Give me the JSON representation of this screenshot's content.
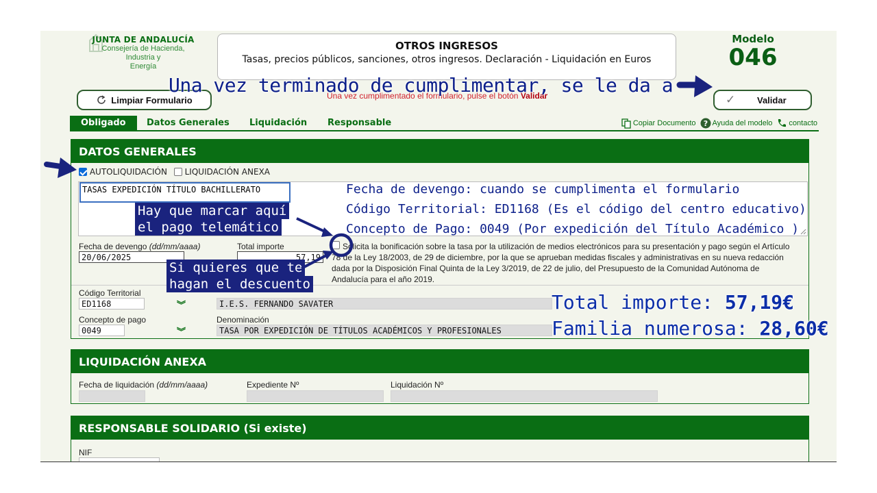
{
  "header": {
    "org_title": "JUNTA DE ANDALUCÍA",
    "org_line1": "Consejería de Hacienda, Industria y",
    "org_line2": "Energía",
    "form_title": "OTROS INGRESOS",
    "form_subtitle": "Tasas, precios públicos, sanciones, otros ingresos. Declaración - Liquidación en Euros",
    "modelo_label": "Modelo",
    "modelo_number": "046"
  },
  "toolbar": {
    "limpiar_label": "Limpiar Formulario",
    "validar_label": "Validar",
    "hint_text": "Una vez cumplimentado el formulario, pulse el botón",
    "hint_bold": "Validar"
  },
  "tabs": [
    {
      "label": "Obligado",
      "active": true
    },
    {
      "label": "Datos Generales",
      "active": false
    },
    {
      "label": "Liquidación",
      "active": false
    },
    {
      "label": "Responsable",
      "active": false
    }
  ],
  "tools": {
    "copiar": "Copiar Documento",
    "ayuda": "Ayuda del modelo",
    "contacto": "contacto"
  },
  "datos_generales": {
    "heading": "DATOS GENERALES",
    "autoliquidacion_label": "AUTOLIQUIDACIÓN",
    "autoliquidacion_checked": true,
    "anexa_label": "LIQUIDACIÓN ANEXA",
    "anexa_checked": false,
    "descripcion": "TASAS EXPEDICIÓN TÍTULO BACHILLERATO",
    "fecha_label": "Fecha de devengo",
    "fecha_format": "(dd/mm/aaaa)",
    "fecha_value": "20/06/2025",
    "total_label": "Total importe",
    "total_value": "57,19",
    "bonificacion_checked": false,
    "bonificacion_text": "Solicita la bonificación sobre la tasa por la utilización de medios electrónicos para su presentación y pago según el Artículo 78 de la Ley 18/2003, de 29 de diciembre, por la que se aprueban medidas fiscales y administrativas en su nueva redacción dada por la Disposición Final Quinta de la Ley 3/2019, de 22 de julio, del Presupuesto de la Comunidad Autónoma de Andalucía para el año 2019.",
    "codigo_label": "Código Territorial",
    "codigo_value": "ED1168",
    "centro_value": "I.E.S. FERNANDO SAVATER",
    "concepto_label": "Concepto de pago",
    "concepto_value": "0049",
    "denominacion_label": "Denominación",
    "denominacion_value": "TASA POR EXPEDICIÓN  DE TÍTULOS ACADÉMICOS Y PROFESIONALES"
  },
  "liquidacion_anexa": {
    "heading": "LIQUIDACIÓN ANEXA",
    "fecha_label": "Fecha de liquidación",
    "fecha_format": "(dd/mm/aaaa)",
    "expediente_label": "Expediente Nº",
    "liquidacion_label": "Liquidación Nº"
  },
  "responsable": {
    "heading": "RESPONSABLE SOLIDARIO (Si existe)",
    "nif_label": "NIF"
  },
  "annotations": {
    "top": "Una vez terminado de cumplimentar, se le da a",
    "fecha_note": "Fecha de devengo: cuando se cumplimenta el formulario",
    "codigo_note": "Código Territorial: ED1168 (Es el código del centro educativo)",
    "concepto_note": "Concepto de Pago: 0049 (Por expedición del Título Académico )",
    "marcar_line1": "Hay que marcar aquí",
    "marcar_line2": "el pago telemático",
    "descuento_line1": "Si quieres que te",
    "descuento_line2": "hagan el descuento",
    "total_label": "Total importe:",
    "total_value": "57,19€",
    "familia_label": "Familia numerosa:",
    "familia_value": "28,60€"
  },
  "colors": {
    "brand_green": "#0a6e14",
    "annotation_blue": "#1a237e",
    "hint_red": "#d01f2a"
  }
}
